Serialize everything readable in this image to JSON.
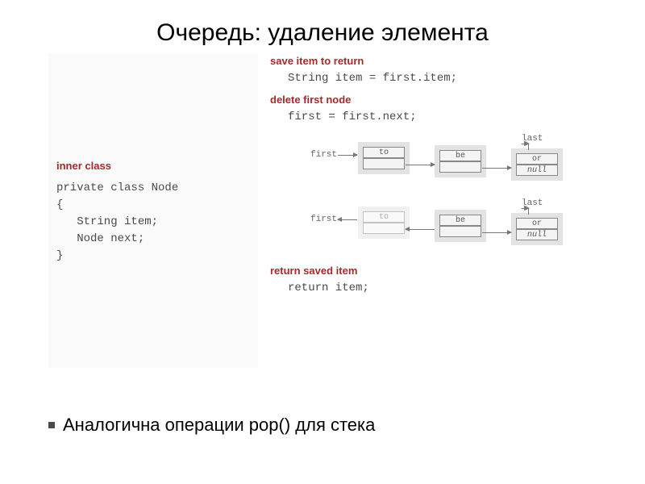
{
  "title": "Очередь: удаление элемента",
  "left": {
    "label": "inner class",
    "code": "private class Node\n{\n   String item;\n   Node next;\n}"
  },
  "right": {
    "sec1": {
      "label": "save item to return",
      "code": "String item = first.item;"
    },
    "sec2": {
      "label": "delete first node",
      "code": "first = first.next;"
    },
    "sec3": {
      "label": "return saved item",
      "code": "return item;"
    }
  },
  "diagram": {
    "first": "first",
    "last": "last",
    "n1_top": "to",
    "n1_bottom": "",
    "n2_top": "be",
    "n2_bottom": "",
    "n3_top": "or",
    "n3_bottom": "null"
  },
  "bullet": "Аналогична операции pop() для стека"
}
